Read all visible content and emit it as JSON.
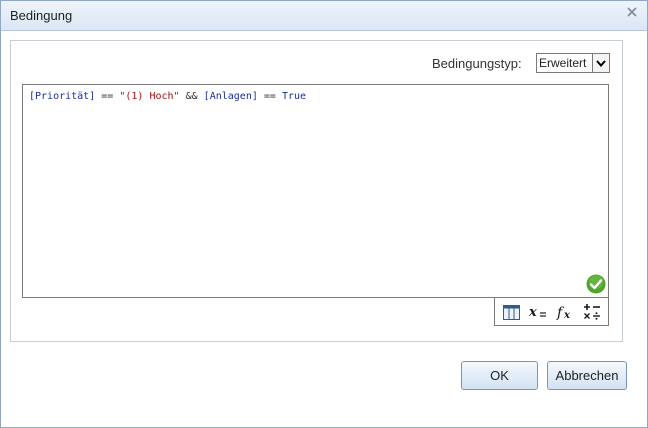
{
  "dialog": {
    "title": "Bedingung"
  },
  "condition_type": {
    "label": "Bedingungstyp:",
    "selected": "Erweitert"
  },
  "expression": {
    "field1": "[Priorität]",
    "op1": "==",
    "string": "\"(1) Hoch\"",
    "op2": "&&",
    "field2": "[Anlagen]",
    "op3": "==",
    "bool": "True"
  },
  "toolbar": {
    "icons": [
      "table-icon",
      "variable-icon",
      "function-icon",
      "operators-icon"
    ]
  },
  "buttons": {
    "ok": "OK",
    "cancel": "Abbrechen"
  },
  "colors": {
    "title_bar": "#dbe7f5",
    "valid_green": "#4fa42c",
    "field_blue": "#1c2f9a",
    "string_red": "#a31515"
  }
}
